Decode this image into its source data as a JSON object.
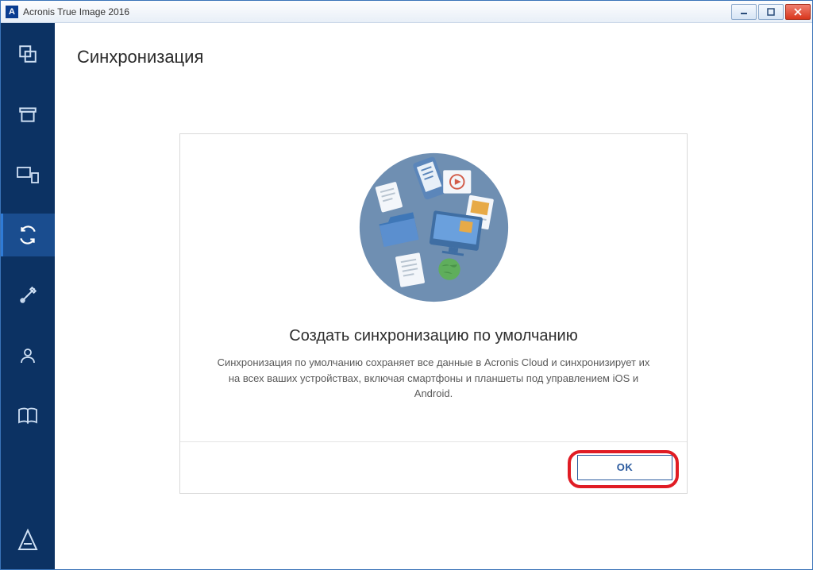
{
  "window": {
    "title": "Acronis True Image 2016"
  },
  "sidebar": {
    "items": [
      {
        "name": "backup",
        "icon": "copy-icon"
      },
      {
        "name": "archive",
        "icon": "archive-icon"
      },
      {
        "name": "dashboard",
        "icon": "device-link-icon"
      },
      {
        "name": "sync",
        "icon": "sync-icon",
        "active": true
      },
      {
        "name": "tools",
        "icon": "tools-icon"
      },
      {
        "name": "account",
        "icon": "user-icon"
      },
      {
        "name": "help",
        "icon": "book-icon"
      }
    ],
    "bottom": {
      "name": "acronis-logo",
      "icon": "acronis-a-icon"
    }
  },
  "page": {
    "title": "Синхронизация"
  },
  "card": {
    "heading": "Создать синхронизацию по умолчанию",
    "description": "Синхронизация по умолчанию сохраняет все данные в Acronis Cloud и синхронизирует их на всех ваших устройствах, включая смартфоны и планшеты под управлением iOS и Android.",
    "ok_label": "OK"
  },
  "colors": {
    "sidebar_bg": "#0c3263",
    "accent": "#2a5a9e",
    "highlight": "#e01c24"
  }
}
